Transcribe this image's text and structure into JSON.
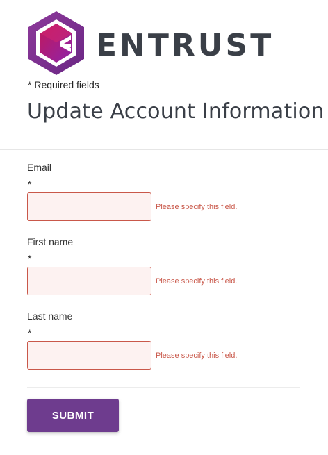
{
  "brand": {
    "wordmark": "ENTRUST",
    "logo_icon": "entrust-hexagon-logo",
    "colors": {
      "logo_purple": "#7b2d8e",
      "logo_magenta": "#c2185b",
      "wordmark": "#3a3f47"
    }
  },
  "form": {
    "required_note": "* Required fields",
    "title": "Update Account Information",
    "fields": [
      {
        "label": "Email",
        "required_mark": "*",
        "value": "",
        "error": "Please specify this field."
      },
      {
        "label": "First name",
        "required_mark": "*",
        "value": "",
        "error": "Please specify this field."
      },
      {
        "label": "Last name",
        "required_mark": "*",
        "value": "",
        "error": "Please specify this field."
      }
    ],
    "submit_label": "SUBMIT",
    "colors": {
      "error": "#c9584a",
      "error_fill": "#fdf2f1",
      "button": "#6e3c8e"
    }
  }
}
